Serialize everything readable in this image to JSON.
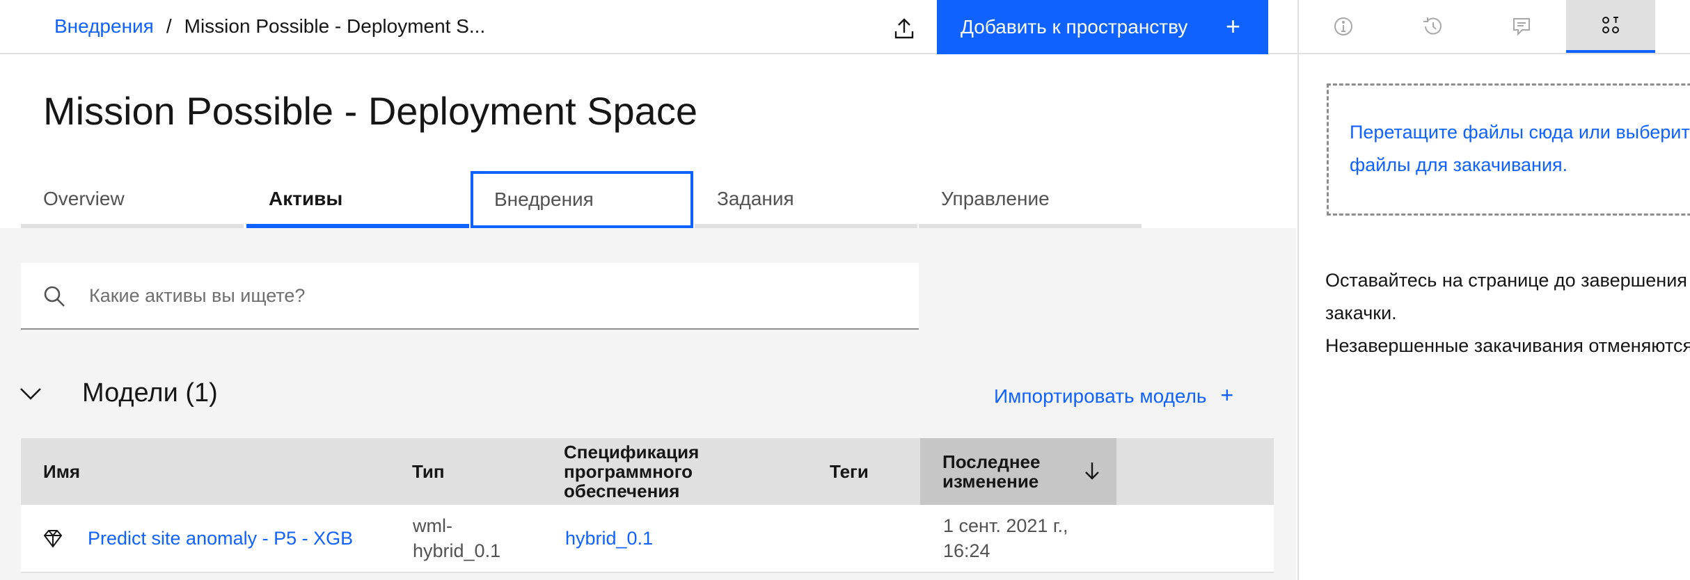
{
  "header": {
    "breadcrumb_link": "Внедрения",
    "breadcrumb_separator": "/",
    "breadcrumb_current": "Mission Possible - Deployment S...",
    "add_button_label": "Добавить к пространству",
    "add_button_icon": "+"
  },
  "page": {
    "title": "Mission Possible - Deployment Space"
  },
  "tabs": [
    {
      "label": "Overview"
    },
    {
      "label": "Активы"
    },
    {
      "label": "Внедрения"
    },
    {
      "label": "Задания"
    },
    {
      "label": "Управление"
    }
  ],
  "search": {
    "placeholder": "Какие активы вы ищете?",
    "value": ""
  },
  "models_section": {
    "title": "Модели (1)",
    "import_label": "Импортировать модель",
    "import_icon": "+"
  },
  "table": {
    "columns": [
      "Имя",
      "Тип",
      "Спецификация программного обеспечения",
      "Теги",
      "Последнее изменение"
    ],
    "rows": [
      {
        "name": "Predict site anomaly - P5 - XGB",
        "type": "wml-hybrid_0.1",
        "software_spec": "hybrid_0.1",
        "tags": "",
        "modified": "1 сент. 2021 г., 16:24"
      }
    ]
  },
  "panel": {
    "tabs": [
      "info-icon",
      "history-icon",
      "comment-icon",
      "data-assets-icon"
    ],
    "dropzone_text": "Перетащите файлы сюда или выберите файлы для закачивания.",
    "note_line1": "Оставайтесь на странице до завершения закачки.",
    "note_line2": "Незавершенные закачивания отменяются."
  },
  "colors": {
    "accent": "#0f62fe",
    "background": "#f4f4f4",
    "header_row": "#e0e0e0"
  }
}
